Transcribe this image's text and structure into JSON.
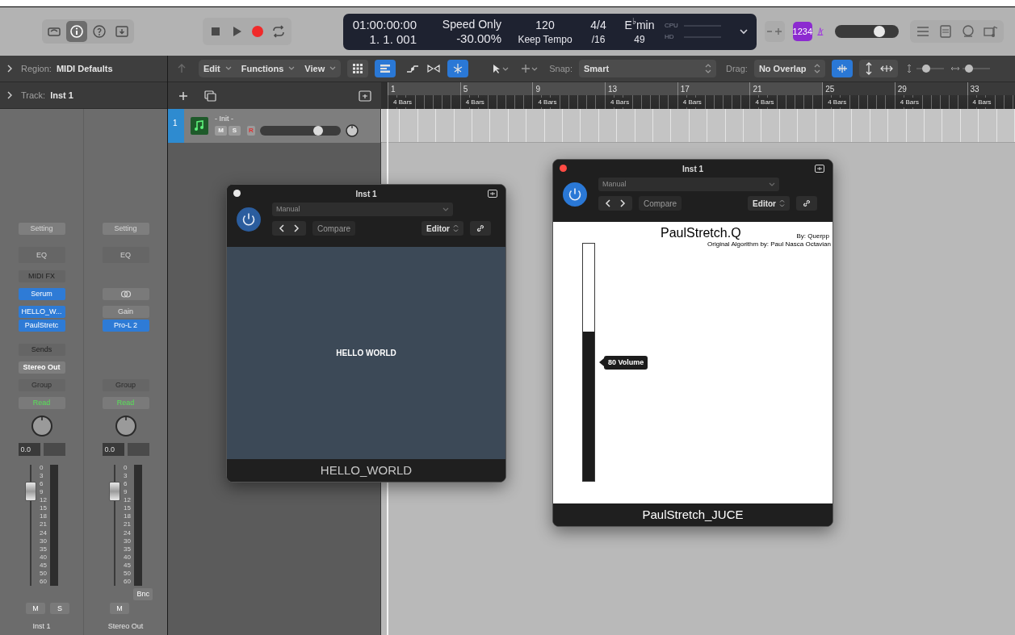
{
  "control_bar": {
    "view_buttons": [
      {
        "kind": "library",
        "selected": false
      },
      {
        "kind": "info",
        "selected": true
      },
      {
        "kind": "help",
        "selected": false
      },
      {
        "kind": "download",
        "selected": false
      }
    ],
    "transport": [
      {
        "kind": "stop",
        "selected": false
      },
      {
        "kind": "play",
        "selected": false
      },
      {
        "kind": "record",
        "selected": false
      },
      {
        "kind": "cycle",
        "selected": false
      }
    ],
    "lcd": {
      "timecode": "01:00:00:00",
      "position": "1. 1. 001",
      "varispeed_mode": "Speed Only",
      "varispeed": "-30.00%",
      "tempo": "120",
      "tempo_mode": "Keep Tempo",
      "signature": "4/4",
      "division": "/16",
      "key": "E$^{♭}$min",
      "key_value": "49",
      "cpu_label": "CPU",
      "hd_label": "HD"
    },
    "count_in": "1234",
    "master_volume": {
      "level": 0.7
    }
  },
  "inspector": {
    "region": {
      "label": "Region:",
      "name": "MIDI Defaults"
    },
    "track": {
      "label": "Track:",
      "name": "Inst 1"
    }
  },
  "channel_strips": [
    {
      "name": "Inst 1",
      "setting": "Setting",
      "eq": "EQ",
      "midi_fx": "MIDI FX",
      "instrument": "Serum",
      "inserts": [
        {
          "name": "HELLO_W...",
          "enabled": true
        },
        {
          "name": "PaulStretc",
          "enabled": true
        }
      ],
      "sends": "Sends",
      "output": "Stereo Out",
      "group": "Group",
      "automation": "Read",
      "volume": "0.0",
      "fader": {
        "level": 0.78
      },
      "scale": [
        "0",
        "3",
        "6",
        "9",
        "12",
        "15",
        "18",
        "21",
        "24",
        "30",
        "35",
        "40",
        "45",
        "50",
        "60"
      ],
      "buttons": [
        "M",
        "S"
      ]
    },
    {
      "name": "Stereo Out",
      "setting": "Setting",
      "eq": "EQ",
      "inserts": [
        {
          "name": "Gain",
          "enabled": false
        },
        {
          "name": "Pro-L 2",
          "enabled": true
        }
      ],
      "group": "Group",
      "automation": "Read",
      "volume": "0.0",
      "fader": {
        "level": 0.78
      },
      "scale": [
        "0",
        "3",
        "6",
        "9",
        "12",
        "15",
        "18",
        "21",
        "24",
        "30",
        "35",
        "40",
        "45",
        "50",
        "60"
      ],
      "bounce": "Bnc",
      "buttons": [
        "M"
      ]
    }
  ],
  "toolbar": {
    "menus": [
      "Edit",
      "Functions",
      "View"
    ],
    "view_modes": [
      {
        "kind": "grid",
        "selected": false
      },
      {
        "kind": "list",
        "selected": true
      }
    ],
    "flex": {
      "selected": true
    },
    "snap_label": "Snap:",
    "snap": "Smart",
    "drag_label": "Drag:",
    "drag": "No Overlap",
    "waveform_zoom": {
      "selected": true
    },
    "vertical_zoom": {
      "level": 0.35
    },
    "horizontal_zoom": {
      "level": 0.25
    }
  },
  "ruler": [
    {
      "bar": "1",
      "length": "4 Bars"
    },
    {
      "bar": "5",
      "length": "4 Bars"
    },
    {
      "bar": "9",
      "length": "4 Bars"
    },
    {
      "bar": "13",
      "length": "4 Bars"
    },
    {
      "bar": "17",
      "length": "4 Bars"
    },
    {
      "bar": "21",
      "length": "4 Bars"
    },
    {
      "bar": "25",
      "length": "4 Bars"
    },
    {
      "bar": "29",
      "length": "4 Bars"
    },
    {
      "bar": "33",
      "length": "4 Bars"
    }
  ],
  "tracks": [
    {
      "number": "1",
      "name": "- Init -",
      "selected": true,
      "mute": "M",
      "solo": "S",
      "record": "R",
      "volume": {
        "level": 0.72
      }
    }
  ],
  "plugin_windows": [
    {
      "kind": "hello",
      "active": false,
      "title": "Inst 1",
      "preset": "Manual",
      "compare": "Compare",
      "view": "Editor",
      "content": {
        "text": "HELLO WORLD"
      },
      "footer": "HELLO_WORLD"
    },
    {
      "kind": "paulstretch",
      "active": true,
      "title": "Inst 1",
      "preset": "Manual",
      "compare": "Compare",
      "view": "Editor",
      "content": {
        "title": "PaulStretch.Q",
        "author": "By: Querpp",
        "credit": "Original Algorithm by: Paul Nasca Octavian",
        "volume": {
          "level": 0.63
        },
        "tooltip": "80 Volume"
      },
      "footer": "PaulStretch_JUCE"
    }
  ]
}
